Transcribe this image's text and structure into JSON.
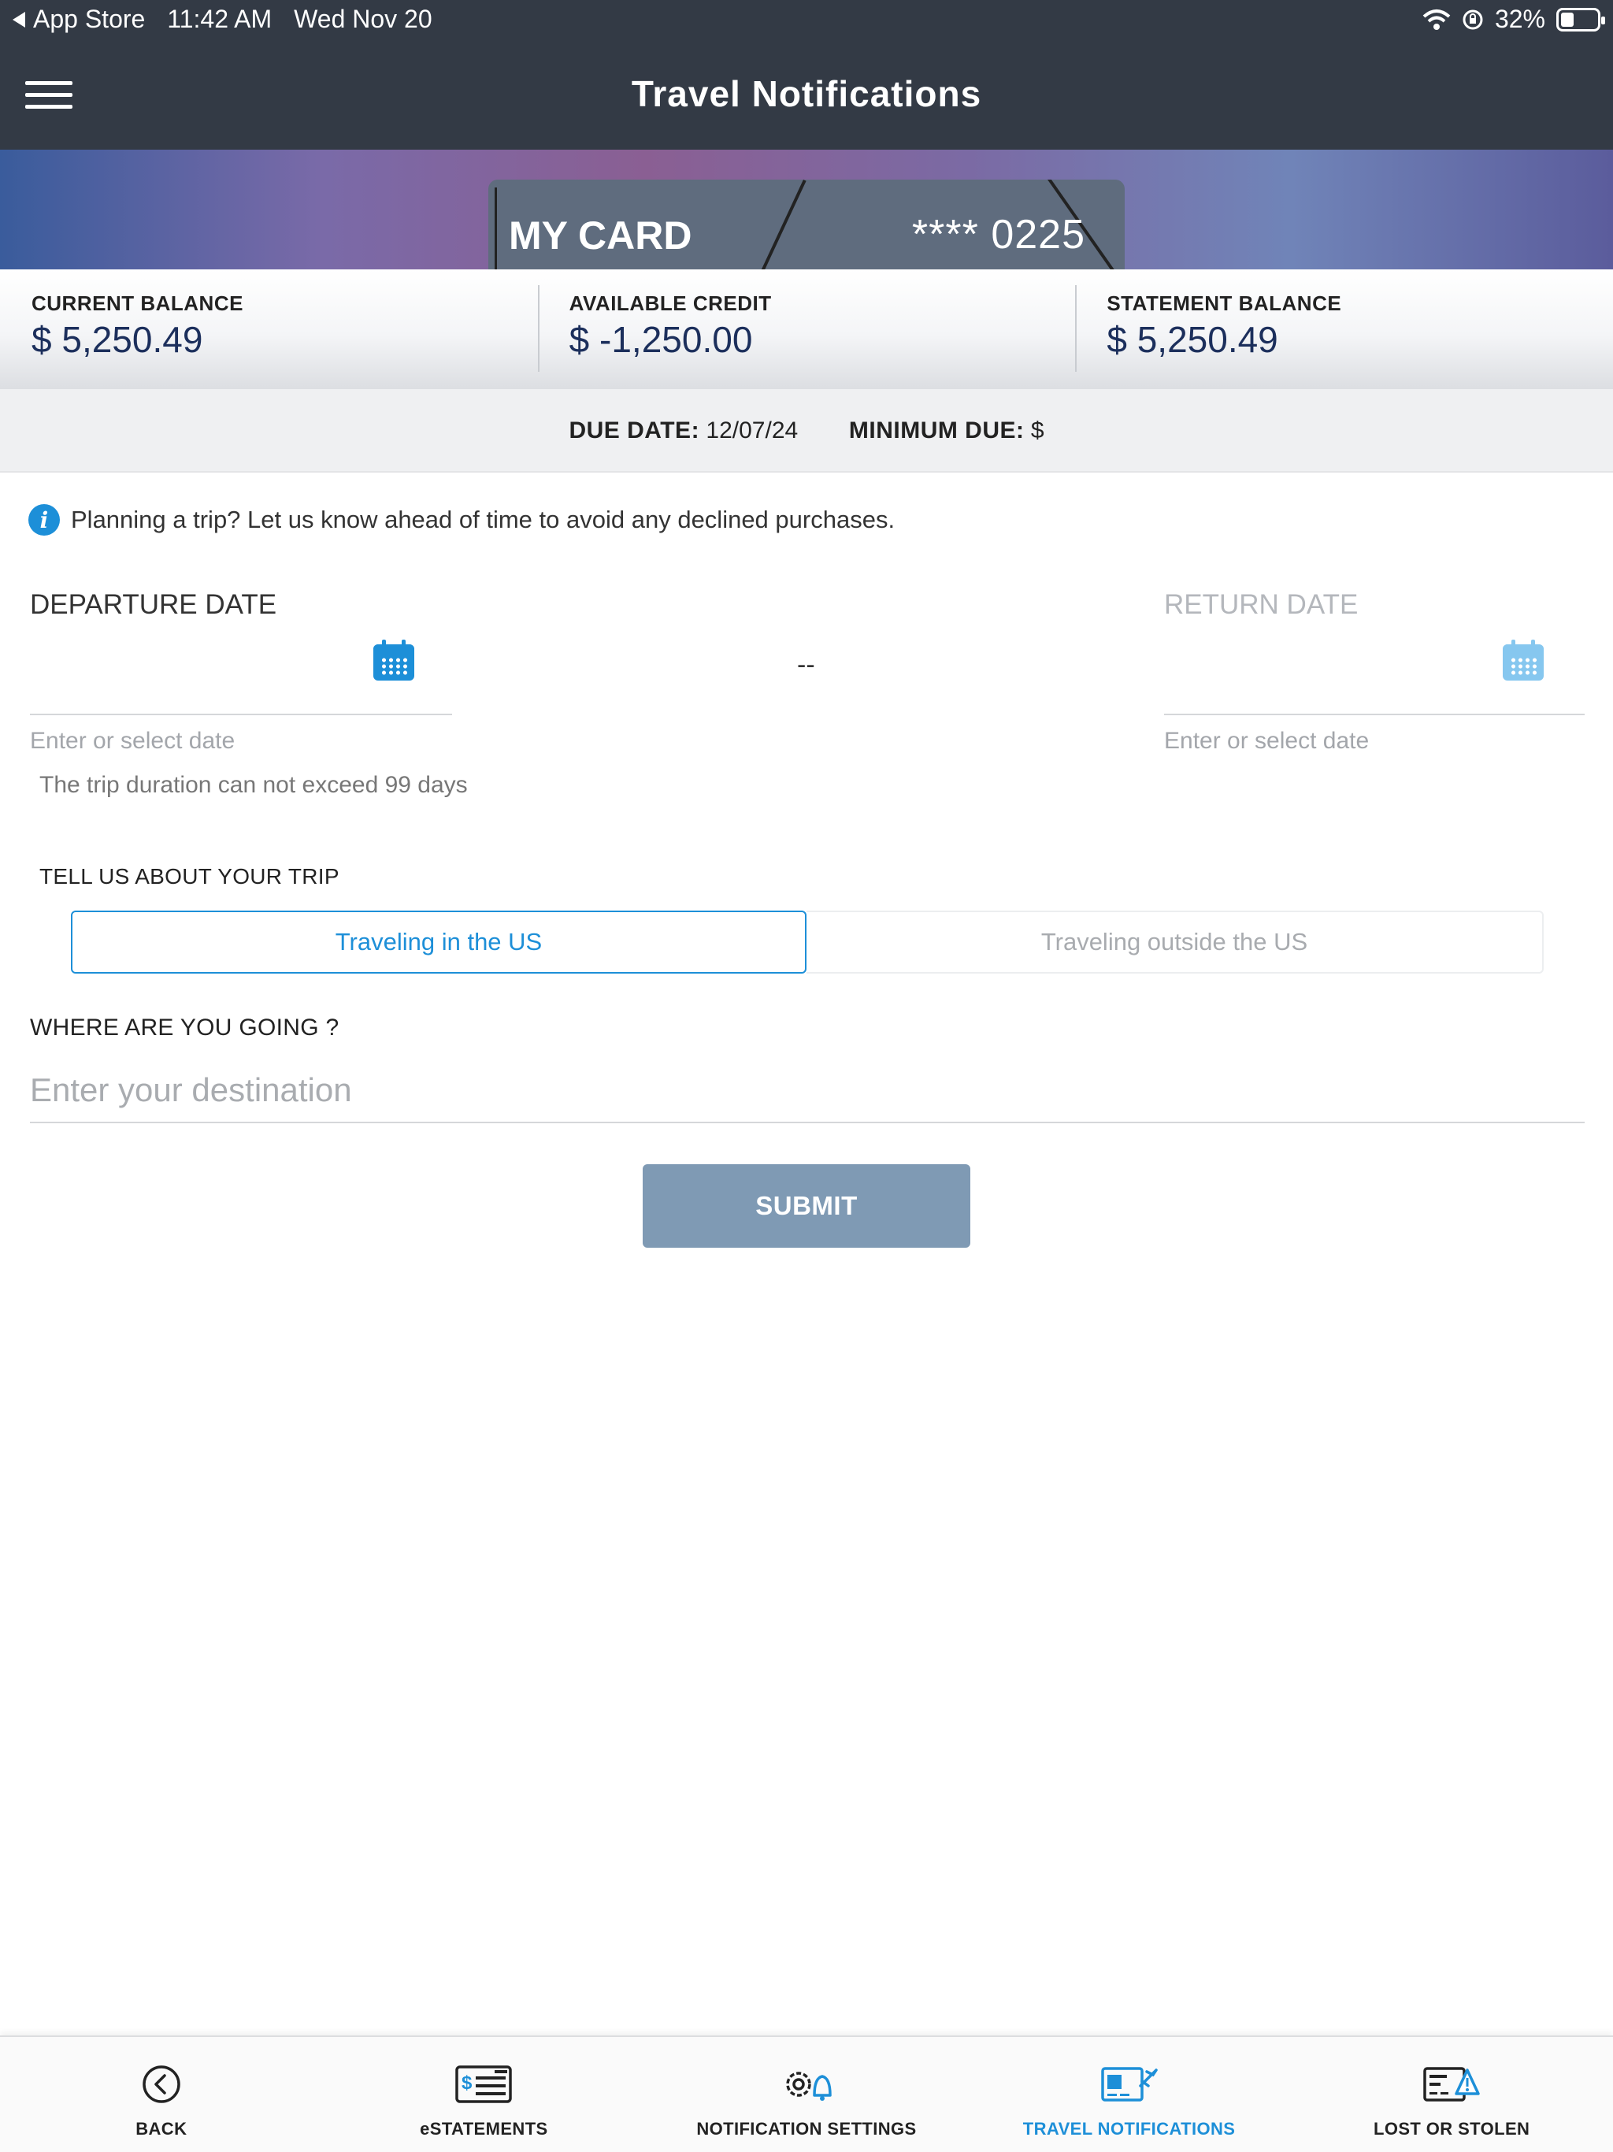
{
  "status_bar": {
    "back_app": "App Store",
    "time": "11:42 AM",
    "date": "Wed Nov 20",
    "battery": "32%",
    "battery_level": 0.32
  },
  "header": {
    "title": "Travel Notifications"
  },
  "card": {
    "name": "MY CARD",
    "number": "**** 0225"
  },
  "balances": [
    {
      "label": "CURRENT BALANCE",
      "value": "$ 5,250.49"
    },
    {
      "label": "AVAILABLE CREDIT",
      "value": "$ -1,250.00"
    },
    {
      "label": "STATEMENT BALANCE",
      "value": "$ 5,250.49"
    }
  ],
  "due": {
    "date_label": "DUE DATE:",
    "date_value": "12/07/24",
    "min_label": "MINIMUM DUE:",
    "min_value": "$"
  },
  "info": {
    "icon": "info-icon",
    "text": "Planning a trip? Let us know ahead of time to avoid any declined purchases."
  },
  "dates": {
    "departure_label": "DEPARTURE DATE",
    "return_label": "RETURN DATE",
    "separator": "--",
    "departure_hint": "Enter or select date",
    "return_hint": "Enter or select date",
    "duration_note": "The trip duration can not exceed 99 days",
    "departure_icon": "calendar-icon",
    "return_icon": "calendar-icon"
  },
  "trip": {
    "label": "TELL US ABOUT YOUR TRIP",
    "options": [
      "Traveling in the US",
      "Traveling outside the US"
    ],
    "selected": "Traveling in the US"
  },
  "destination": {
    "label": "WHERE ARE YOU GOING ?",
    "placeholder": "Enter your destination",
    "value": ""
  },
  "submit_label": "SUBMIT",
  "tabs": [
    {
      "label": "BACK",
      "icon": "back-circle-icon",
      "active": false
    },
    {
      "label": "eSTATEMENTS",
      "icon": "statement-icon",
      "active": false
    },
    {
      "label": "NOTIFICATION SETTINGS",
      "icon": "gear-bell-icon",
      "active": false
    },
    {
      "label": "TRAVEL NOTIFICATIONS",
      "icon": "card-plane-icon",
      "active": true
    },
    {
      "label": "LOST OR STOLEN",
      "icon": "card-warning-icon",
      "active": false
    }
  ],
  "colors": {
    "header_bg": "#333a45",
    "accent": "#1d8fd8",
    "balance_text": "#1c2f5c",
    "submit_bg": "#7f9ab4"
  }
}
